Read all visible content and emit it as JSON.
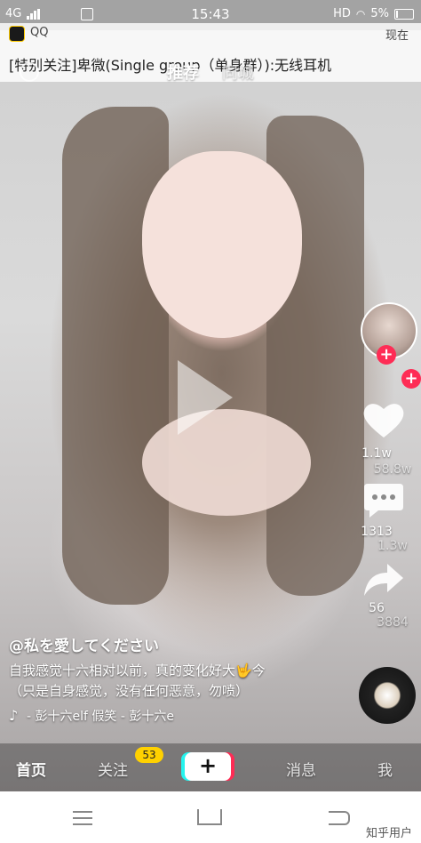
{
  "status_bar": {
    "network": "4G",
    "time": "15:43",
    "hd_label": "HD",
    "battery": "5%"
  },
  "notification": {
    "app_name": "QQ",
    "time": "现在",
    "message": "[特别关注]卑微(Single group（单身群）):无线耳机"
  },
  "top_tabs": {
    "active": "推荐",
    "inactive": "同城"
  },
  "rail": {
    "likes": "1.1w",
    "likes_behind": "58.8w",
    "comments": "1313",
    "comments_behind": "1.3w",
    "shares": "56",
    "shares_behind": "3884"
  },
  "caption": {
    "handle": "@私を愛してください",
    "line1": "自我感觉十六相对以前，真的变化好大🤟今",
    "line2": "（只是自身感觉，没有任何恶意，勿喷）",
    "music": "- 彭十六elf   假笑 - 彭十六e"
  },
  "bottom_nav": {
    "home": "首页",
    "follow": "关注",
    "follow_badge": "53",
    "plus": "+",
    "messages": "消息",
    "me": "我"
  },
  "watermark": "知乎用户",
  "colors": {
    "accent_red": "#fe2c55",
    "accent_cyan": "#25f4ee",
    "badge_yellow": "#ffd100"
  }
}
